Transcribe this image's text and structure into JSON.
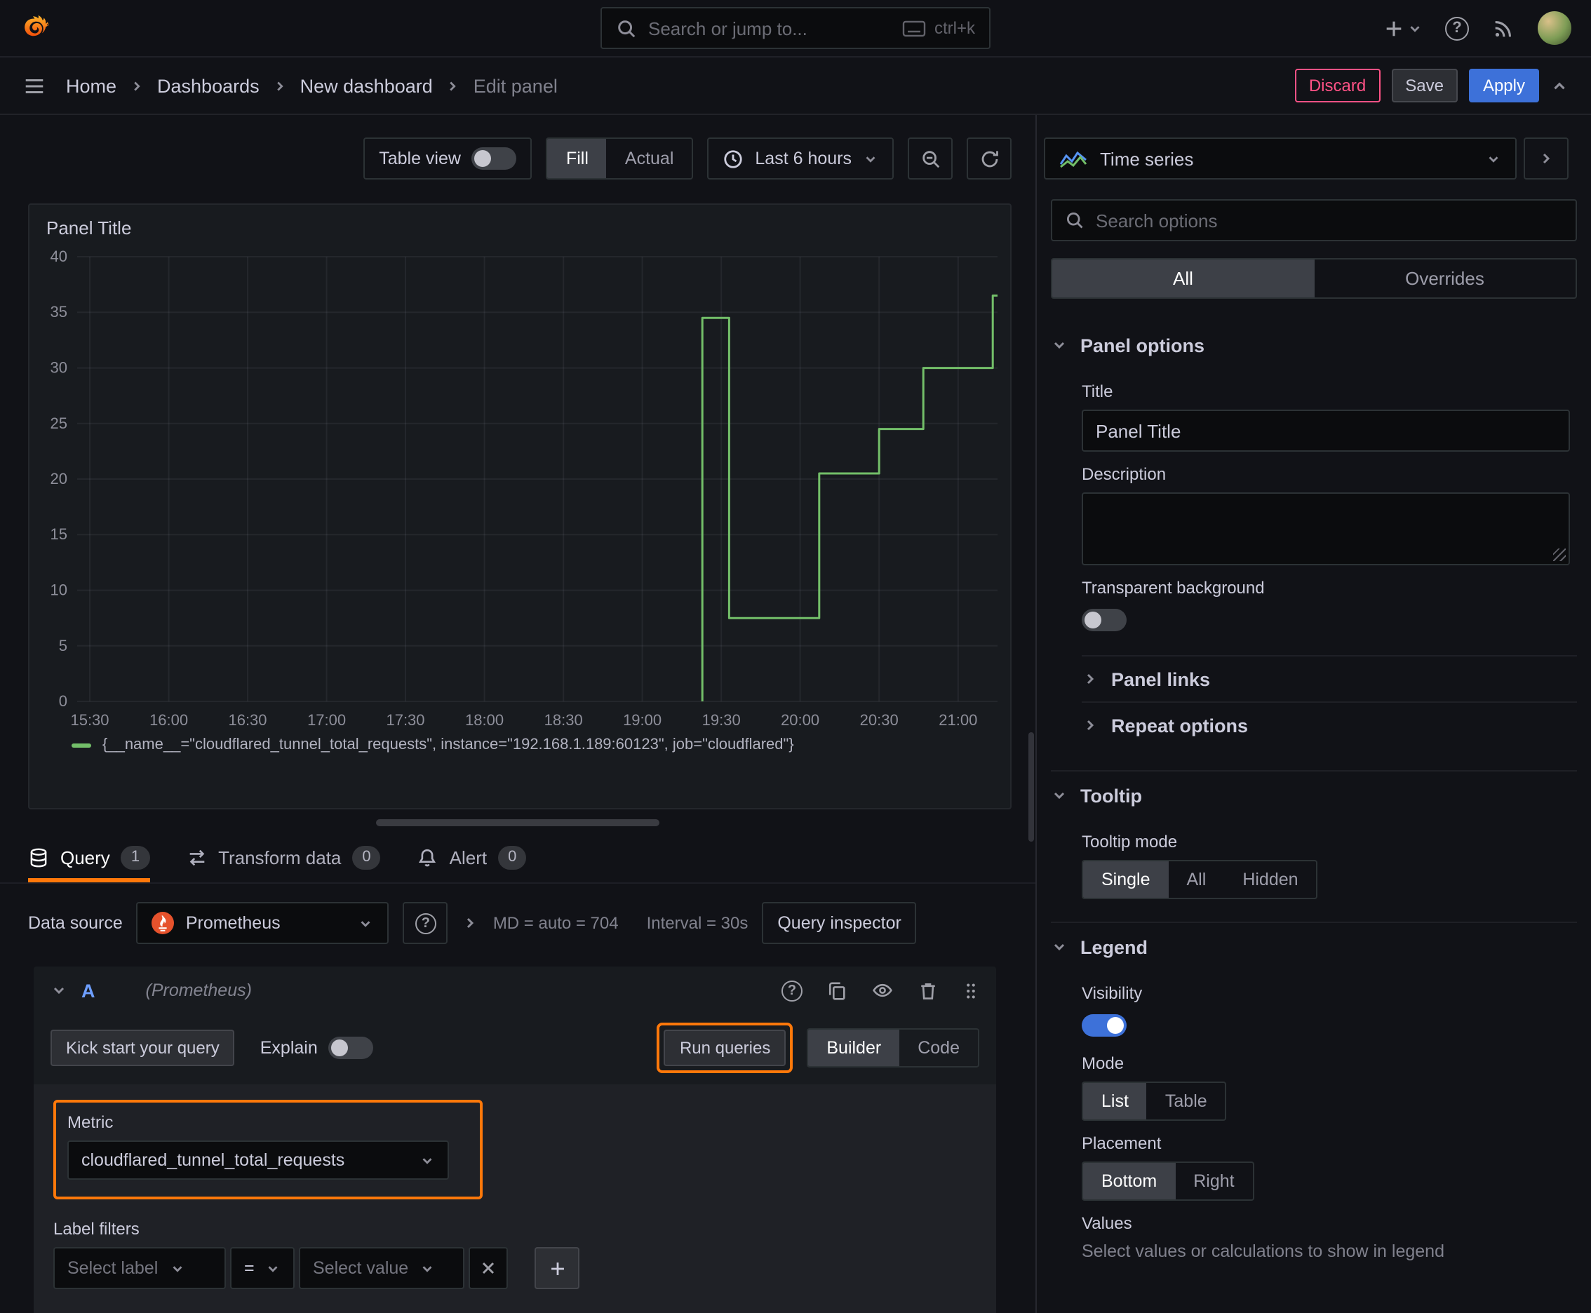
{
  "colors": {
    "bg": "#111217",
    "panel_bg": "#181b1f",
    "editor_bg": "#1f2126",
    "input_bg": "#0b0c0e",
    "border": "#2c3235",
    "text": "#ccccdc",
    "text_muted": "#8e8e99",
    "accent_blue": "#3d71d9",
    "link_blue": "#6e9fff",
    "danger": "#ff5286",
    "highlight_orange": "#ff780a",
    "series_green": "#73bf69",
    "selected_segment": "#3d4047",
    "secondary_button": "#2d2f34"
  },
  "topbar": {
    "search_placeholder": "Search or jump to...",
    "search_shortcut": "ctrl+k"
  },
  "breadcrumbs": {
    "items": [
      "Home",
      "Dashboards",
      "New dashboard",
      "Edit panel"
    ]
  },
  "nav_actions": {
    "discard": "Discard",
    "save": "Save",
    "apply": "Apply"
  },
  "viz_toolbar": {
    "table_view": "Table view",
    "fill": "Fill",
    "actual": "Actual",
    "time_range": "Last 6 hours"
  },
  "panel": {
    "title": "Panel Title"
  },
  "chart_data": {
    "type": "line",
    "title": "Panel Title",
    "x_range": [
      15.42,
      21.25
    ],
    "ylim": [
      0,
      40
    ],
    "y_ticks": [
      0,
      5,
      10,
      15,
      20,
      25,
      30,
      35,
      40
    ],
    "x_ticks": [
      "15:30",
      "16:00",
      "16:30",
      "17:00",
      "17:30",
      "18:00",
      "18:30",
      "19:00",
      "19:30",
      "20:00",
      "20:30",
      "21:00"
    ],
    "x_tick_values": [
      15.5,
      16,
      16.5,
      17,
      17.5,
      18,
      18.5,
      19,
      19.5,
      20,
      20.5,
      21
    ],
    "grid": true,
    "legend_position": "bottom",
    "series": [
      {
        "name": "{__name__=\"cloudflared_tunnel_total_requests\", instance=\"192.168.1.189:60123\", job=\"cloudflared\"}",
        "color": "#73bf69",
        "points": [
          [
            19.38,
            0
          ],
          [
            19.38,
            34.5
          ],
          [
            19.55,
            34.5
          ],
          [
            19.55,
            7.5
          ],
          [
            20.12,
            7.5
          ],
          [
            20.12,
            20.5
          ],
          [
            20.5,
            20.5
          ],
          [
            20.5,
            24.5
          ],
          [
            20.78,
            24.5
          ],
          [
            20.78,
            30
          ],
          [
            21.22,
            30
          ],
          [
            21.22,
            36.5
          ],
          [
            21.25,
            36.5
          ]
        ]
      }
    ]
  },
  "tabs": {
    "query": {
      "label": "Query",
      "count": "1"
    },
    "transform": {
      "label": "Transform data",
      "count": "0"
    },
    "alert": {
      "label": "Alert",
      "count": "0"
    }
  },
  "query": {
    "datasource_label": "Data source",
    "datasource_name": "Prometheus",
    "md_text": "MD = auto = 704",
    "interval_text": "Interval = 30s",
    "inspector": "Query inspector",
    "ref_id": "A",
    "ref_hint": "(Prometheus)",
    "kickstart": "Kick start your query",
    "explain": "Explain",
    "run_queries": "Run queries",
    "builder": "Builder",
    "code": "Code",
    "metric_label": "Metric",
    "metric_value": "cloudflared_tunnel_total_requests",
    "label_filters_label": "Label filters",
    "select_label_placeholder": "Select label",
    "operator": "=",
    "select_value_placeholder": "Select value"
  },
  "options": {
    "viz_name": "Time series",
    "search_placeholder": "Search options",
    "tabs": {
      "all": "All",
      "overrides": "Overrides"
    },
    "panel_options": {
      "header": "Panel options",
      "title_label": "Title",
      "title_value": "Panel Title",
      "description_label": "Description",
      "description_value": "",
      "transparent_label": "Transparent background",
      "panel_links": "Panel links",
      "repeat_options": "Repeat options"
    },
    "tooltip": {
      "header": "Tooltip",
      "mode_label": "Tooltip mode",
      "single": "Single",
      "all": "All",
      "hidden": "Hidden"
    },
    "legend": {
      "header": "Legend",
      "visibility_label": "Visibility",
      "mode_label": "Mode",
      "list": "List",
      "table": "Table",
      "placement_label": "Placement",
      "bottom": "Bottom",
      "right": "Right",
      "values_label": "Values",
      "values_hint": "Select values or calculations to show in legend"
    }
  }
}
